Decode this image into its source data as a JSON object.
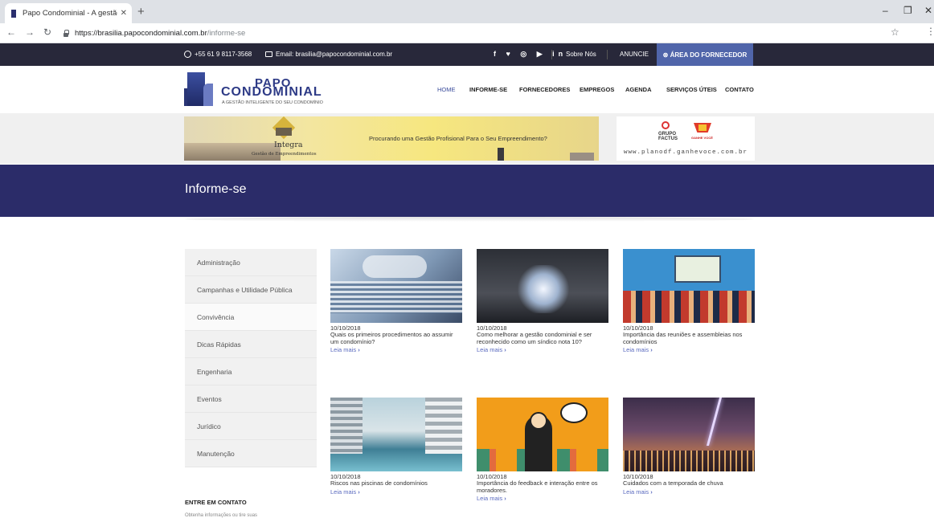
{
  "browser": {
    "tab_title": "Papo Condominial - A gestão inte",
    "url_host": "https://brasilia.papocondominial.com.br",
    "url_path": "/informe-se"
  },
  "topbar": {
    "phone": "+55 61 9 8117-3568",
    "email": "Email: brasilia@papocondominial.com.br",
    "social": "f ♥ ◎ ▶ in",
    "about": "Sobre Nós",
    "anuncie": "ANUNCIE",
    "fornecedor": "⊛ ÁREA DO FORNECEDOR"
  },
  "logo": {
    "line1": "PAPO",
    "line2": "CONDOMINIAL",
    "tagline": "A GESTÃO INTELIGENTE DO SEU CONDOMÍNIO"
  },
  "menu": {
    "home": "HOME",
    "informe": "INFORME-SE",
    "fornecedores": "FORNECEDORES",
    "empregos": "EMPREGOS",
    "agenda": "AGENDA",
    "servicos": "SERVIÇOS ÚTEIS",
    "contato": "CONTATO"
  },
  "banner1": {
    "brand": "Integra",
    "sub": "Gestão de Empreendimentos",
    "cta": "Procurando uma Gestão Profisional Para o Seu Empreendimento?"
  },
  "banner2": {
    "group": "GRUPO FACTUS",
    "ganhe": "GANHE VOCÊ",
    "site": "www.planodf.ganhevoce.com.br"
  },
  "page": {
    "title": "Informe-se"
  },
  "sidebar": {
    "categories": [
      "Administração",
      "Campanhas e Utilidade Pública",
      "Convivência",
      "Dicas Rápidas",
      "Engenharia",
      "Eventos",
      "Jurídico",
      "Manutenção"
    ],
    "contact_heading": "ENTRE EM CONTATO",
    "contact_text": "Obtenha informações ou tire suas"
  },
  "posts": [
    {
      "date": "10/10/2018",
      "title": "Quais os primeiros procedimentos ao assumir um condomínio?",
      "more": "Leia mais"
    },
    {
      "date": "10/10/2018",
      "title": "Como melhorar a gestão condominial e ser reconhecido como um síndico nota 10?",
      "more": "Leia mais"
    },
    {
      "date": "10/10/2018",
      "title": "Importância das reuniões e assembleias nos condomínios",
      "more": "Leia mais"
    },
    {
      "date": "10/10/2018",
      "title": "Riscos nas piscinas de condomínios",
      "more": "Leia mais"
    },
    {
      "date": "10/10/2018",
      "title": "Importância do feedback e interação entre os moradores.",
      "more": "Leia mais"
    },
    {
      "date": "10/10/2018",
      "title": "Cuidados com a temporada de chuva",
      "more": "Leia mais"
    }
  ],
  "colors": {
    "topbar": "#28283a",
    "accent": "#5065aa",
    "title_band": "#2b2c69",
    "link": "#5a6abf"
  }
}
